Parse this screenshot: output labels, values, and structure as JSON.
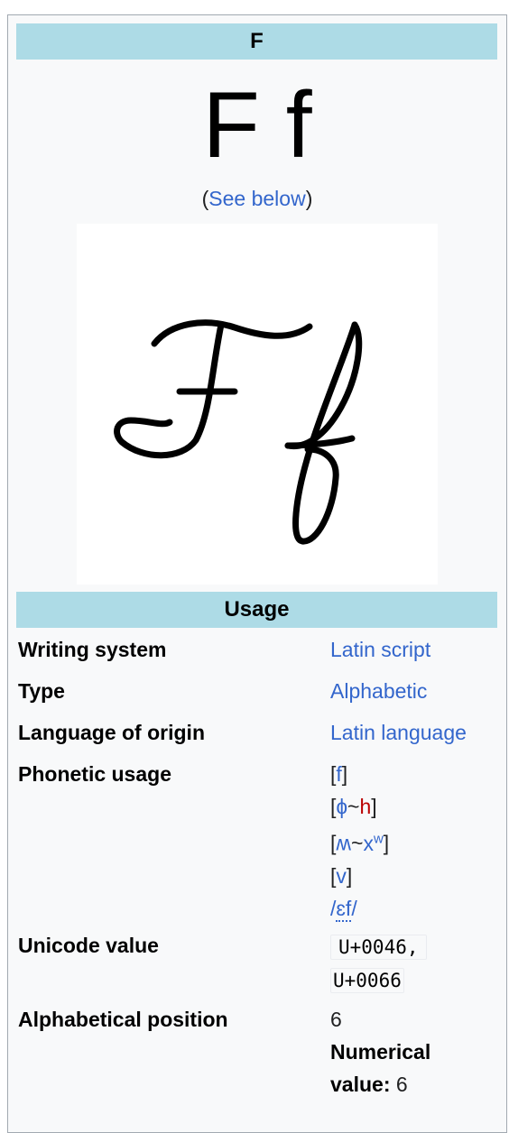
{
  "title": "F",
  "glyphs": "F f",
  "see_below": {
    "open": "(",
    "link": "See below",
    "close": ")"
  },
  "usage_header": "Usage",
  "rows": {
    "writing_system": {
      "label": "Writing system",
      "value": "Latin script"
    },
    "type": {
      "label": "Type",
      "value": "Alphabetic"
    },
    "language": {
      "label": "Language of origin",
      "value": "Latin language"
    },
    "phonetic": {
      "label": "Phonetic usage",
      "f": "f",
      "phi": "ɸ",
      "tilde": "~",
      "h": "h",
      "wh": "ʍ",
      "xw": "x",
      "xw_sup": "w",
      "v": "v",
      "ef": "ɛf"
    },
    "unicode": {
      "label": "Unicode value",
      "code1": "U+0046",
      "sep": ",",
      "code2": "U+0066"
    },
    "alpha": {
      "label": "Alphabetical position",
      "value": "6",
      "numerical_label": "Numerical value:",
      "numerical_value": "6"
    }
  }
}
